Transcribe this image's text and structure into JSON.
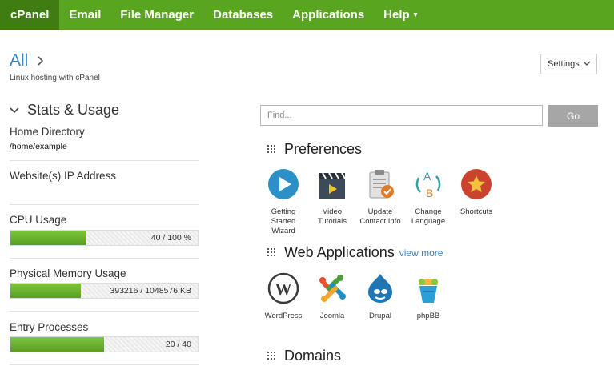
{
  "nav": {
    "items": [
      "cPanel",
      "Email",
      "File Manager",
      "Databases",
      "Applications",
      "Help"
    ],
    "help_caret": "▾"
  },
  "header": {
    "title": "All",
    "subtitle": "Linux hosting with cPanel",
    "settings_label": "Settings"
  },
  "stats": {
    "title": "Stats & Usage",
    "home_directory": {
      "label": "Home Directory",
      "value": "/home/example"
    },
    "ip_address": {
      "label": "Website(s) IP Address"
    },
    "cpu": {
      "label": "CPU Usage",
      "text": "40 / 100 %",
      "fraction": 0.4
    },
    "memory": {
      "label": "Physical Memory Usage",
      "text": "393216 / 1048576 KB",
      "fraction": 0.375
    },
    "entry": {
      "label": "Entry Processes",
      "text": "20 / 40",
      "fraction": 0.5
    }
  },
  "search": {
    "placeholder": "Find...",
    "button": "Go"
  },
  "preferences": {
    "title": "Preferences",
    "items": [
      {
        "label": "Getting Started Wizard",
        "icon": "play-icon",
        "color": "#2d8fc8"
      },
      {
        "label": "Video Tutorials",
        "icon": "clapperboard-icon",
        "color": "#3d4a5a"
      },
      {
        "label": "Update Contact Info",
        "icon": "clipboard-icon",
        "color": "#e07b2a"
      },
      {
        "label": "Change Language",
        "icon": "language-icon",
        "color": "#2fa3a8"
      },
      {
        "label": "Shortcuts",
        "icon": "star-icon",
        "color": "#c9432f"
      }
    ]
  },
  "web_apps": {
    "title": "Web Applications",
    "view_more": "view more",
    "items": [
      {
        "label": "WordPress",
        "icon": "wordpress-icon",
        "color": "#3a3a3a"
      },
      {
        "label": "Joomla",
        "icon": "joomla-icon",
        "color": "#e8502f"
      },
      {
        "label": "Drupal",
        "icon": "drupal-icon",
        "color": "#1e76b5"
      },
      {
        "label": "phpBB",
        "icon": "phpbb-icon",
        "color": "#2c9fd9"
      }
    ]
  },
  "domains": {
    "title": "Domains"
  }
}
